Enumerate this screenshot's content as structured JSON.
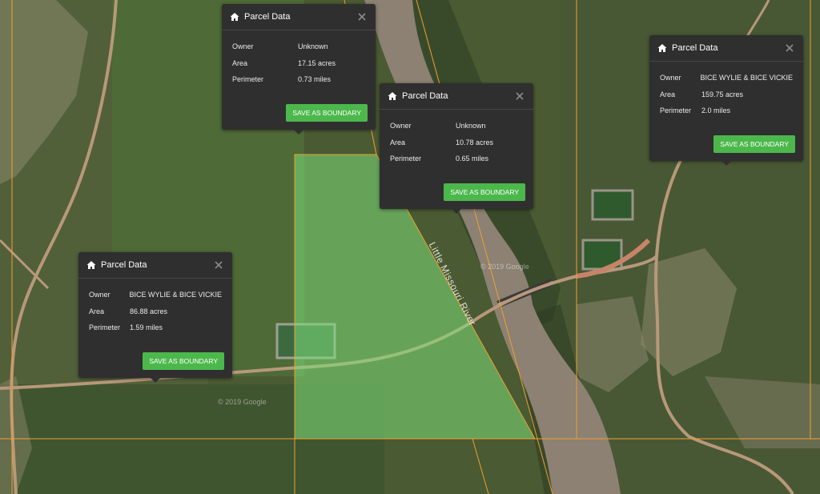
{
  "popup_heading": "Parcel Data",
  "save_label": "SAVE AS BOUNDARY",
  "fields": {
    "owner": "Owner",
    "area": "Area",
    "perimeter": "Perimeter"
  },
  "parcels": [
    {
      "id": "top-center",
      "owner": "Unknown",
      "area": "17.15 acres",
      "perimeter": "0.73 miles"
    },
    {
      "id": "middle",
      "owner": "Unknown",
      "area": "10.78 acres",
      "perimeter": "0.65 miles"
    },
    {
      "id": "right",
      "owner": "BICE WYLIE & BICE VICKIE",
      "area": "159.75 acres",
      "perimeter": "2.0 miles"
    },
    {
      "id": "left",
      "owner": "BICE WYLIE & BICE VICKIE",
      "area": "86.88 acres",
      "perimeter": "1.59 miles"
    }
  ],
  "map": {
    "river_label": "Little Missouri River",
    "watermarks": [
      "© 2019 Google",
      "© 2019 Google"
    ],
    "colors": {
      "parcel_line": "#f0a030",
      "selection_fill": "#7de07a",
      "river": "#8c8172",
      "terrain": "#4a5a32",
      "button": "#4cb84c",
      "popup_bg": "#2f2f2f"
    }
  }
}
